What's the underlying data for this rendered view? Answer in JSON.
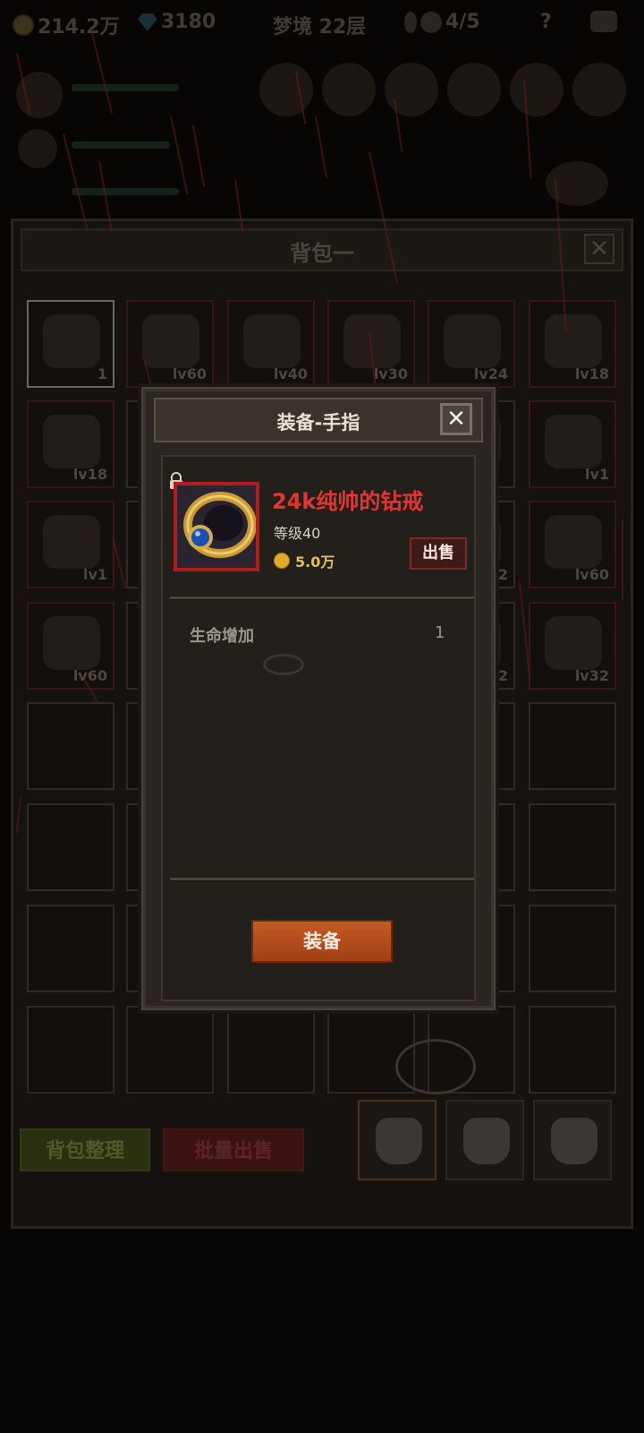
{
  "hud": {
    "gold": "214.2万",
    "gems": "3180",
    "stage": "梦境 22层",
    "skull_count": "4/5",
    "help": "?"
  },
  "bag": {
    "title": "背包一",
    "close": "✕",
    "slots": [
      {
        "lv": "1"
      },
      {
        "lv": "lv60"
      },
      {
        "lv": "lv40"
      },
      {
        "lv": "lv30"
      },
      {
        "lv": "lv24"
      },
      {
        "lv": "lv18"
      },
      {
        "lv": "lv18"
      },
      {
        "lv": ""
      },
      {
        "lv": ""
      },
      {
        "lv": ""
      },
      {
        "lv": ""
      },
      {
        "lv": "lv1"
      },
      {
        "lv": "lv1"
      },
      {
        "lv": ""
      },
      {
        "lv": ""
      },
      {
        "lv": ""
      },
      {
        "lv": "2"
      },
      {
        "lv": "lv60"
      },
      {
        "lv": "lv60"
      },
      {
        "lv": ""
      },
      {
        "lv": ""
      },
      {
        "lv": ""
      },
      {
        "lv": "2"
      },
      {
        "lv": "lv32"
      }
    ],
    "sort_button": "背包整理",
    "batch_sell_button": "批量出售"
  },
  "modal": {
    "title": "装备-手指",
    "close": "✕",
    "item_name": "24k纯帅的钻戒",
    "item_level": "等级40",
    "price": "5.0万",
    "sell_button": "出售",
    "stats": [
      {
        "name": "生命增加",
        "value": "1"
      }
    ],
    "equip_button": "装备"
  },
  "colors": {
    "item_name": "#e83431",
    "equip_button": "#c65a23",
    "rarity_border": "#b21c1c"
  }
}
